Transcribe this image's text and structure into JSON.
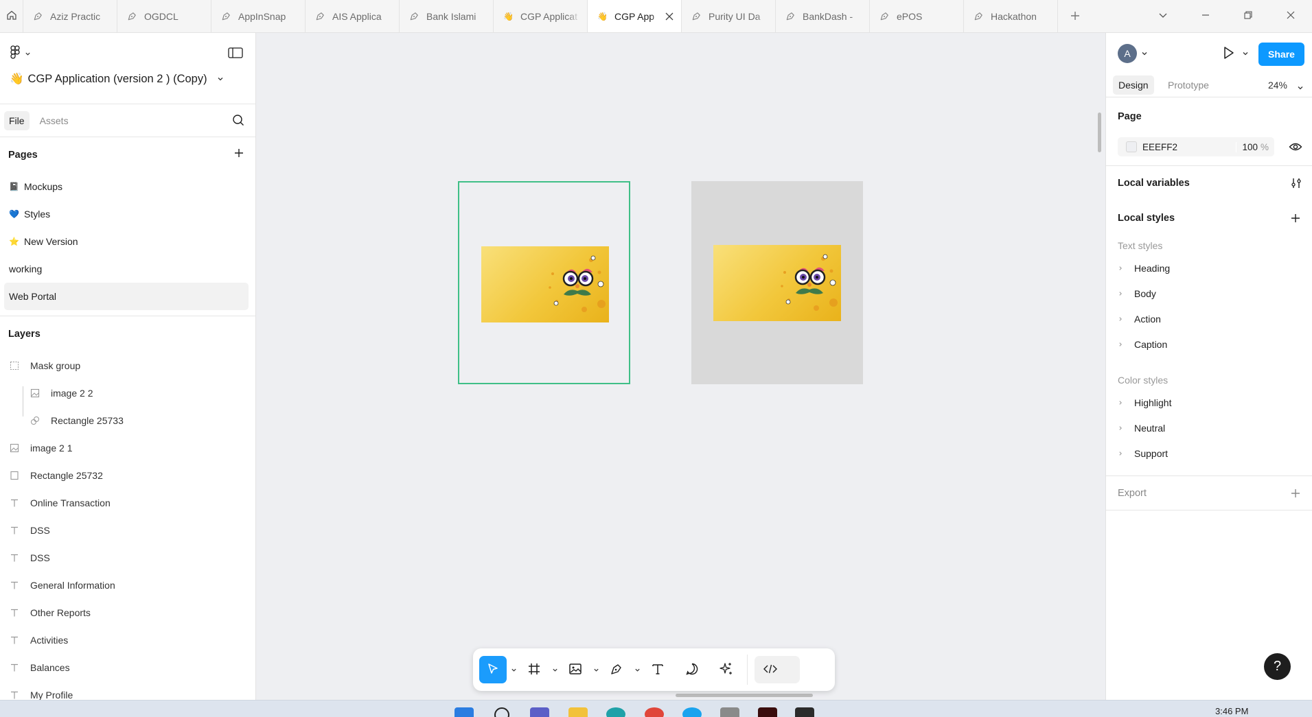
{
  "tabs": [
    {
      "label": "Aziz Practic",
      "active": false
    },
    {
      "label": "OGDCL",
      "active": false
    },
    {
      "label": "AppInSnap",
      "active": false
    },
    {
      "label": "AIS Applica",
      "active": false
    },
    {
      "label": "Bank Islami",
      "active": false
    },
    {
      "label": "CGP Applicat",
      "active": false
    },
    {
      "label": "CGP App",
      "active": true
    },
    {
      "label": "Purity UI Da",
      "active": false
    },
    {
      "label": "BankDash -",
      "active": false
    },
    {
      "label": "ePOS",
      "active": false
    },
    {
      "label": "Hackathon",
      "active": false
    }
  ],
  "file": {
    "emoji": "👋",
    "title": "CGP Application (version 2 ) (Copy)"
  },
  "left_tabs": {
    "file": "File",
    "assets": "Assets"
  },
  "pages": {
    "heading": "Pages",
    "items": [
      {
        "icon": "📓",
        "label": "Mockups"
      },
      {
        "icon": "💙",
        "label": "Styles"
      },
      {
        "icon": "⭐",
        "label": "New Version"
      },
      {
        "icon": "",
        "label": "working"
      },
      {
        "icon": "",
        "label": "Web Portal",
        "active": true
      }
    ]
  },
  "layers": {
    "heading": "Layers",
    "items": [
      {
        "type": "mask",
        "label": "Mask group"
      },
      {
        "type": "image",
        "label": "image 2 2",
        "child": true
      },
      {
        "type": "rect-mask",
        "label": "Rectangle 25733",
        "child": true
      },
      {
        "type": "image",
        "label": "image 2 1"
      },
      {
        "type": "rect",
        "label": "Rectangle 25732"
      },
      {
        "type": "text",
        "label": "Online Transaction"
      },
      {
        "type": "text",
        "label": "DSS"
      },
      {
        "type": "text",
        "label": "DSS"
      },
      {
        "type": "text",
        "label": "General Information"
      },
      {
        "type": "text",
        "label": "Other Reports"
      },
      {
        "type": "text",
        "label": "Activities"
      },
      {
        "type": "text",
        "label": "Balances"
      },
      {
        "type": "text",
        "label": "My Profile"
      }
    ]
  },
  "right": {
    "avatar_initial": "A",
    "share_label": "Share",
    "tabs": {
      "design": "Design",
      "prototype": "Prototype"
    },
    "zoom": "24%",
    "page_section": {
      "title": "Page",
      "fill_hex": "EEEFF2",
      "opacity": "100",
      "pct": "%"
    },
    "local_variables": "Local variables",
    "local_styles": "Local styles",
    "text_styles": {
      "heading": "Text styles",
      "items": [
        "Heading",
        "Body",
        "Action",
        "Caption"
      ]
    },
    "color_styles": {
      "heading": "Color styles",
      "items": [
        "Highlight",
        "Neutral",
        "Support"
      ]
    },
    "export": "Export"
  },
  "help_label": "?",
  "clock": "3:46 PM",
  "colors": {
    "accent": "#0d99ff",
    "selection": "#3fbf87",
    "canvas": "#eeeff2"
  }
}
